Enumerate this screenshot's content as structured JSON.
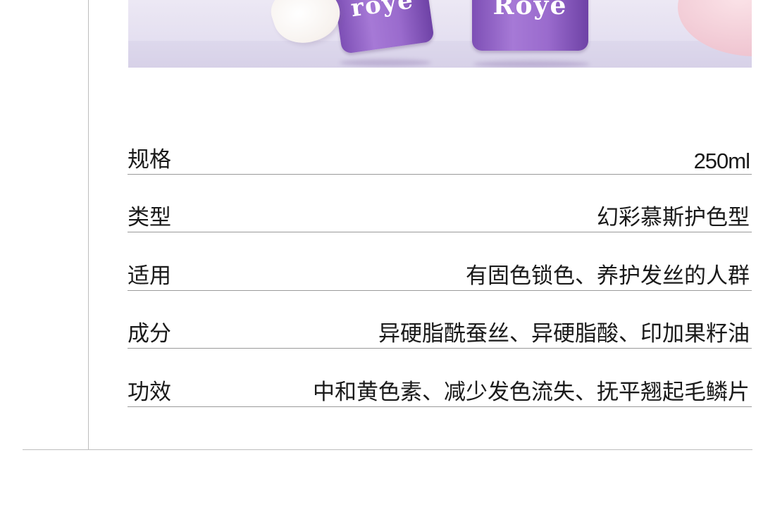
{
  "product_image": {
    "bottle_left_logo": "roye",
    "bottle_right_logo": "Roye"
  },
  "specs": [
    {
      "label": "规格",
      "value": "250ml"
    },
    {
      "label": "类型",
      "value": "幻彩慕斯护色型"
    },
    {
      "label": "适用",
      "value": "有固色锁色、养护发丝的人群"
    },
    {
      "label": "成分",
      "value": "异硬脂酰蚕丝、异硬脂酸、印加果籽油"
    },
    {
      "label": "功效",
      "value": "中和黄色素、减少发色流失、抚平翘起毛鳞片"
    }
  ],
  "colors": {
    "text": "#1a1a1a",
    "rule": "#9a9a9a",
    "frame_line": "#bdbdbd",
    "bottle_purple": "#9a6bcd",
    "background_lavender": "#e3def0"
  }
}
